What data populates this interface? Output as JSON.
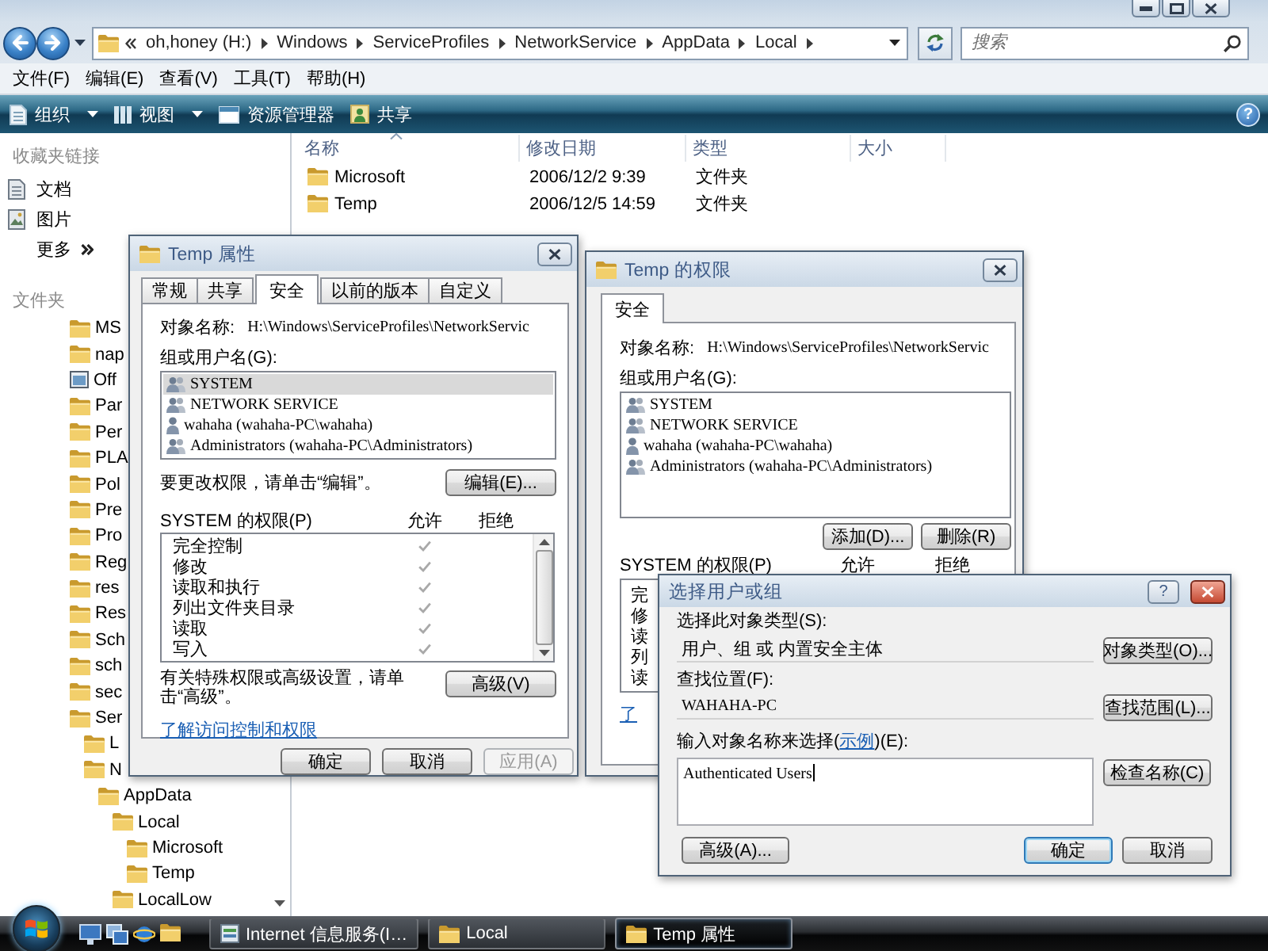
{
  "explorer": {
    "address": {
      "crumbs": [
        "oh,honey (H:)",
        "Windows",
        "ServiceProfiles",
        "NetworkService",
        "AppData",
        "Local"
      ]
    },
    "search": {
      "placeholder": "搜索"
    },
    "menu": [
      "文件(F)",
      "编辑(E)",
      "查看(V)",
      "工具(T)",
      "帮助(H)"
    ],
    "toolbar": {
      "items": [
        {
          "label": "组织",
          "dropdown": true
        },
        {
          "label": "视图",
          "dropdown": true
        },
        {
          "label": "资源管理器",
          "dropdown": false
        },
        {
          "label": "共享",
          "dropdown": false
        }
      ],
      "help": "?"
    },
    "favorites": {
      "title": "收藏夹链接",
      "items": [
        "文档",
        "图片"
      ],
      "more": "更多"
    },
    "folders": {
      "title": "文件夹",
      "tree": [
        {
          "label": "MS",
          "kind": "folder"
        },
        {
          "label": "nap",
          "kind": "folder"
        },
        {
          "label": "Off",
          "kind": "special"
        },
        {
          "label": "Par",
          "kind": "folder"
        },
        {
          "label": "Per",
          "kind": "folder"
        },
        {
          "label": "PLA",
          "kind": "folder"
        },
        {
          "label": "Pol",
          "kind": "folder"
        },
        {
          "label": "Pre",
          "kind": "folder"
        },
        {
          "label": "Pro",
          "kind": "folder"
        },
        {
          "label": "Reg",
          "kind": "folder"
        },
        {
          "label": "res",
          "kind": "folder"
        },
        {
          "label": "Res",
          "kind": "folder"
        },
        {
          "label": "Sch",
          "kind": "folder"
        },
        {
          "label": "sch",
          "kind": "folder"
        },
        {
          "label": "sec",
          "kind": "folder"
        },
        {
          "label": "Ser",
          "kind": "folder",
          "children": [
            {
              "label": "L",
              "kind": "folder"
            },
            {
              "label": "N",
              "kind": "folder",
              "children": [
                {
                  "label": "AppData",
                  "kind": "folder",
                  "children": [
                    {
                      "label": "Local",
                      "kind": "folder",
                      "children": [
                        {
                          "label": "Microsoft",
                          "kind": "folder"
                        },
                        {
                          "label": "Temp",
                          "kind": "folder"
                        }
                      ]
                    },
                    {
                      "label": "LocalLow",
                      "kind": "folder"
                    }
                  ]
                }
              ]
            }
          ]
        }
      ]
    },
    "columns": [
      "名称",
      "修改日期",
      "类型",
      "大小"
    ],
    "rows": [
      {
        "name": "Microsoft",
        "modified": "2006/12/2 9:39",
        "type": "文件夹"
      },
      {
        "name": "Temp",
        "modified": "2006/12/5 14:59",
        "type": "文件夹"
      }
    ]
  },
  "properties_dialog": {
    "title": "Temp 属性",
    "tabs": [
      {
        "label": "常规",
        "selected": false
      },
      {
        "label": "共享",
        "selected": false
      },
      {
        "label": "安全",
        "selected": true
      },
      {
        "label": "以前的版本",
        "selected": false
      },
      {
        "label": "自定义",
        "selected": false
      }
    ],
    "object_label": "对象名称:",
    "object_path": "H:\\Windows\\ServiceProfiles\\NetworkServic",
    "groups_label": "组或用户名(G):",
    "principals": [
      {
        "name": "SYSTEM",
        "kind": "group",
        "selected": true
      },
      {
        "name": "NETWORK SERVICE",
        "kind": "group",
        "selected": false
      },
      {
        "name": "wahaha (wahaha-PC\\wahaha)",
        "kind": "user",
        "selected": false
      },
      {
        "name": "Administrators (wahaha-PC\\Administrators)",
        "kind": "group",
        "selected": false
      }
    ],
    "edit_hint": "要更改权限，请单击“编辑”。",
    "edit_button": "编辑(E)...",
    "permissions_label": "SYSTEM 的权限(P)",
    "allow_label": "允许",
    "deny_label": "拒绝",
    "permissions": [
      {
        "name": "完全控制",
        "allow": true,
        "deny": false
      },
      {
        "name": "修改",
        "allow": true,
        "deny": false
      },
      {
        "name": "读取和执行",
        "allow": true,
        "deny": false
      },
      {
        "name": "列出文件夹目录",
        "allow": true,
        "deny": false
      },
      {
        "name": "读取",
        "allow": true,
        "deny": false
      },
      {
        "name": "写入",
        "allow": true,
        "deny": false
      }
    ],
    "advanced_hint": "有关特殊权限或高级设置，请单击“高级”。",
    "advanced_button": "高级(V)",
    "help_link": "了解访问控制和权限",
    "buttons": [
      {
        "label": "确定",
        "disabled": false
      },
      {
        "label": "取消",
        "disabled": false
      },
      {
        "label": "应用(A)",
        "disabled": true
      }
    ]
  },
  "permissions_dialog": {
    "title": "Temp 的权限",
    "tabs": [
      {
        "label": "安全",
        "selected": true
      }
    ],
    "object_label": "对象名称:",
    "object_path": "H:\\Windows\\ServiceProfiles\\NetworkServic",
    "groups_label": "组或用户名(G):",
    "principals": [
      {
        "name": "SYSTEM",
        "kind": "group",
        "selected": false
      },
      {
        "name": "NETWORK SERVICE",
        "kind": "group",
        "selected": false
      },
      {
        "name": "wahaha (wahaha-PC\\wahaha)",
        "kind": "user",
        "selected": false
      },
      {
        "name": "Administrators (wahaha-PC\\Administrators)",
        "kind": "group",
        "selected": false
      }
    ],
    "buttons": [
      "添加(D)...",
      "删除(R)"
    ],
    "permissions_label": "SYSTEM 的权限(P)",
    "allow_label": "允许",
    "deny_label": "拒绝",
    "permissions": [
      "完",
      "修",
      "读",
      "列",
      "读"
    ],
    "help_link": "了"
  },
  "select_dialog": {
    "title": "选择用户或组",
    "help": "?",
    "type_label": "选择此对象类型(S):",
    "type_value": "用户、组 或 内置安全主体",
    "type_button": "对象类型(O)...",
    "location_label": "查找位置(F):",
    "location_value": "WAHAHA-PC",
    "location_button": "查找范围(L)...",
    "names_label": {
      "before": "输入对象名称来选择(",
      "link": "示例",
      "after": ")(E):"
    },
    "names_value": "Authenticated Users",
    "check_button": "检查名称(C)",
    "buttons": [
      {
        "label": "高级(A)...",
        "default": false
      },
      {
        "label": "确定",
        "default": true
      },
      {
        "label": "取消",
        "default": false
      }
    ]
  },
  "taskbar": {
    "tasks": [
      {
        "label": "Internet 信息服务(I…",
        "kind": "app",
        "selected": false
      },
      {
        "label": "Local",
        "kind": "folder",
        "selected": false
      },
      {
        "label": "Temp 属性",
        "kind": "folder",
        "selected": true
      }
    ]
  }
}
